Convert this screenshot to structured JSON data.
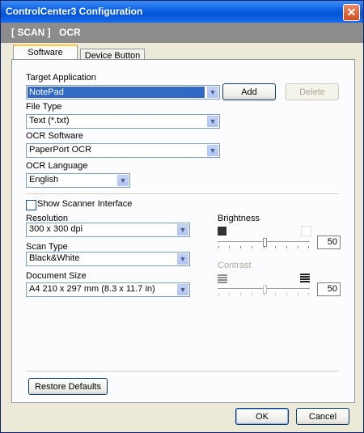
{
  "window": {
    "title": "ControlCenter3 Configuration"
  },
  "header": {
    "scan_label": "[ SCAN ]",
    "ocr_label": "OCR"
  },
  "tabs": [
    {
      "label": "Software Button",
      "active": true
    },
    {
      "label": "Device Button",
      "active": false
    }
  ],
  "target_application": {
    "label": "Target Application",
    "value": "NotePad",
    "add_label": "Add",
    "delete_label": "Delete"
  },
  "file_type": {
    "label": "File Type",
    "value": "Text (*.txt)"
  },
  "ocr_software": {
    "label": "OCR Software",
    "value": "PaperPort OCR"
  },
  "ocr_language": {
    "label": "OCR Language",
    "value": "English"
  },
  "show_scanner_interface": {
    "label": "Show Scanner Interface",
    "checked": false
  },
  "resolution": {
    "label": "Resolution",
    "value": "300 x 300 dpi"
  },
  "scan_type": {
    "label": "Scan Type",
    "value": "Black&White"
  },
  "document_size": {
    "label": "Document Size",
    "value": "A4 210 x 297 mm (8.3 x 11.7 in)"
  },
  "brightness": {
    "label": "Brightness",
    "value": "50",
    "level": 0.5
  },
  "contrast": {
    "label": "Contrast",
    "value": "50",
    "level": 0.5,
    "enabled": false
  },
  "footer": {
    "restore_label": "Restore Defaults",
    "ok_label": "OK",
    "cancel_label": "Cancel"
  },
  "colors": {
    "title_bar": "#0a5fe0",
    "header_band": "#8c8c8c",
    "selection": "#316ac5",
    "tab_highlight": "#ffc83c"
  }
}
